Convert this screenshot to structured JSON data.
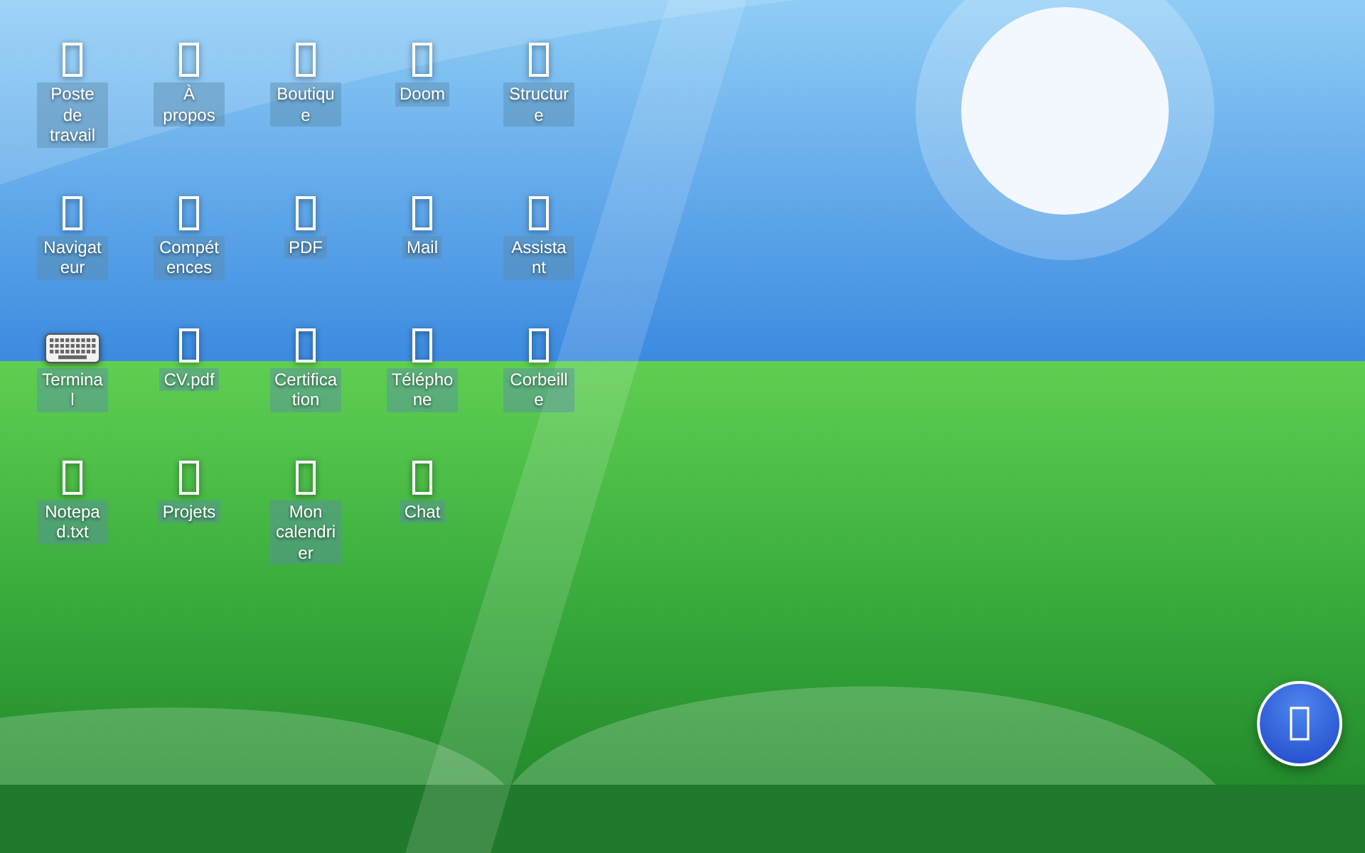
{
  "desktop_icons": [
    {
      "label": "Poste de travail",
      "kind": "blank"
    },
    {
      "label": "À propos",
      "kind": "blank"
    },
    {
      "label": "Boutique",
      "kind": "blank"
    },
    {
      "label": "Doom",
      "kind": "blank"
    },
    {
      "label": "Structure",
      "kind": "blank"
    },
    {
      "label": "Navigateur",
      "kind": "blank"
    },
    {
      "label": "Compétences",
      "kind": "blank"
    },
    {
      "label": "PDF",
      "kind": "blank"
    },
    {
      "label": "Mail",
      "kind": "blank"
    },
    {
      "label": "Assistant",
      "kind": "blank"
    },
    {
      "label": "Terminal",
      "kind": "keyboard"
    },
    {
      "label": "CV.pdf",
      "kind": "blank"
    },
    {
      "label": "Certification",
      "kind": "blank"
    },
    {
      "label": "Téléphone",
      "kind": "blank"
    },
    {
      "label": "Corbeille",
      "kind": "blank"
    },
    {
      "label": "Notepad.txt",
      "kind": "blank"
    },
    {
      "label": "Projets",
      "kind": "blank"
    },
    {
      "label": "Mon calendrier",
      "kind": "blank"
    },
    {
      "label": "Chat",
      "kind": "blank"
    }
  ]
}
